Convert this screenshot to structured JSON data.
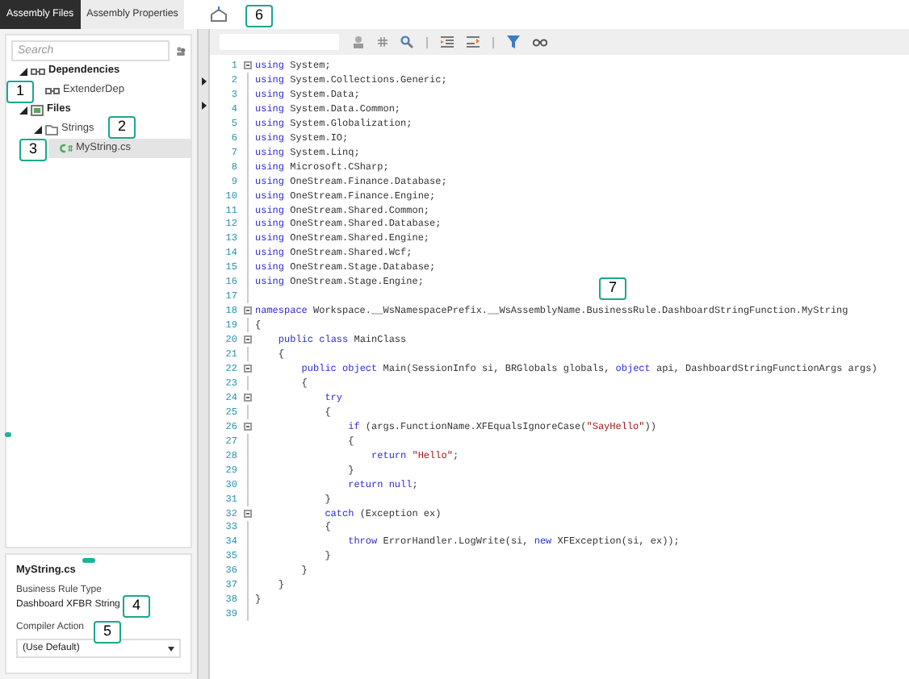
{
  "tabs": [
    {
      "label": "Assembly Files",
      "selected": true
    },
    {
      "label": "Assembly Properties",
      "selected": false
    }
  ],
  "search": {
    "placeholder": "Search"
  },
  "tree": [
    {
      "label": "Dependencies",
      "kind": "deps",
      "expanded": true,
      "selected": false,
      "children": [
        {
          "label": "ExtenderDep",
          "kind": "dep",
          "selected": false
        }
      ]
    },
    {
      "label": "Files",
      "kind": "files",
      "expanded": true,
      "selected": false,
      "children": [
        {
          "label": "Strings",
          "kind": "folder",
          "expanded": true,
          "selected": false,
          "children": [
            {
              "label": "MyString.cs",
              "kind": "cs",
              "selected": true
            }
          ]
        }
      ]
    }
  ],
  "properties": {
    "title": "MyString.cs",
    "fields": [
      {
        "kind": "text",
        "label": "Business Rule Type",
        "value": "Dashboard XFBR String"
      },
      {
        "kind": "dropdown",
        "label": "Compiler Action",
        "value": "(Use Default)"
      }
    ]
  },
  "code": [
    {
      "n": "1",
      "fold": true,
      "tokens": [
        {
          "kind": "keyword",
          "t": "using"
        },
        {
          "kind": "plain",
          "t": " System;"
        }
      ]
    },
    {
      "n": "2",
      "fold": false,
      "tokens": [
        {
          "kind": "keyword",
          "t": "using"
        },
        {
          "kind": "plain",
          "t": " System.Collections.Generic;"
        }
      ]
    },
    {
      "n": "3",
      "fold": false,
      "tokens": [
        {
          "kind": "keyword",
          "t": "using"
        },
        {
          "kind": "plain",
          "t": " System.Data;"
        }
      ]
    },
    {
      "n": "4",
      "fold": false,
      "tokens": [
        {
          "kind": "keyword",
          "t": "using"
        },
        {
          "kind": "plain",
          "t": " System.Data.Common;"
        }
      ]
    },
    {
      "n": "5",
      "fold": false,
      "tokens": [
        {
          "kind": "keyword",
          "t": "using"
        },
        {
          "kind": "plain",
          "t": " System.Globalization;"
        }
      ]
    },
    {
      "n": "6",
      "fold": false,
      "tokens": [
        {
          "kind": "keyword",
          "t": "using"
        },
        {
          "kind": "plain",
          "t": " System.IO;"
        }
      ]
    },
    {
      "n": "7",
      "fold": false,
      "tokens": [
        {
          "kind": "keyword",
          "t": "using"
        },
        {
          "kind": "plain",
          "t": " System.Linq;"
        }
      ]
    },
    {
      "n": "8",
      "fold": false,
      "tokens": [
        {
          "kind": "keyword",
          "t": "using"
        },
        {
          "kind": "plain",
          "t": " Microsoft.CSharp;"
        }
      ]
    },
    {
      "n": "9",
      "fold": false,
      "tokens": [
        {
          "kind": "keyword",
          "t": "using"
        },
        {
          "kind": "plain",
          "t": " OneStream.Finance.Database;"
        }
      ]
    },
    {
      "n": "10",
      "fold": false,
      "tokens": [
        {
          "kind": "keyword",
          "t": "using"
        },
        {
          "kind": "plain",
          "t": " OneStream.Finance.Engine;"
        }
      ]
    },
    {
      "n": "11",
      "fold": false,
      "tokens": [
        {
          "kind": "keyword",
          "t": "using"
        },
        {
          "kind": "plain",
          "t": " OneStream.Shared.Common;"
        }
      ]
    },
    {
      "n": "12",
      "fold": false,
      "tokens": [
        {
          "kind": "keyword",
          "t": "using"
        },
        {
          "kind": "plain",
          "t": " OneStream.Shared.Database;"
        }
      ]
    },
    {
      "n": "13",
      "fold": false,
      "tokens": [
        {
          "kind": "keyword",
          "t": "using"
        },
        {
          "kind": "plain",
          "t": " OneStream.Shared.Engine;"
        }
      ]
    },
    {
      "n": "14",
      "fold": false,
      "tokens": [
        {
          "kind": "keyword",
          "t": "using"
        },
        {
          "kind": "plain",
          "t": " OneStream.Shared.Wcf;"
        }
      ]
    },
    {
      "n": "15",
      "fold": false,
      "tokens": [
        {
          "kind": "keyword",
          "t": "using"
        },
        {
          "kind": "plain",
          "t": " OneStream.Stage.Database;"
        }
      ]
    },
    {
      "n": "16",
      "fold": false,
      "tokens": [
        {
          "kind": "keyword",
          "t": "using"
        },
        {
          "kind": "plain",
          "t": " OneStream.Stage.Engine;"
        }
      ]
    },
    {
      "n": "17",
      "fold": false
    },
    {
      "n": "18",
      "fold": true,
      "tokens": [
        {
          "kind": "keyword",
          "t": "namespace"
        },
        {
          "kind": "plain",
          "t": " Workspace.__WsNamespacePrefix.__WsAssemblyName.BusinessRule.DashboardStringFunction.MyString"
        }
      ]
    },
    {
      "n": "19",
      "fold": false,
      "tokens": [
        {
          "kind": "plain",
          "t": "{"
        }
      ]
    },
    {
      "n": "20",
      "fold": true,
      "tokens": [
        {
          "kind": "keyword",
          "t": "    public"
        },
        {
          "kind": "keyword",
          "t": " class"
        },
        {
          "kind": "plain",
          "t": " MainClass"
        }
      ]
    },
    {
      "n": "21",
      "fold": false,
      "tokens": [
        {
          "kind": "plain",
          "t": "    {"
        }
      ]
    },
    {
      "n": "22",
      "fold": true,
      "tokens": [
        {
          "kind": "keyword",
          "t": "        public"
        },
        {
          "kind": "keyword",
          "t": " object"
        },
        {
          "kind": "plain",
          "t": " Main(SessionInfo si, BRGlobals globals, "
        },
        {
          "kind": "keyword",
          "t": "object"
        },
        {
          "kind": "plain",
          "t": " api, DashboardStringFunctionArgs args)"
        }
      ]
    },
    {
      "n": "23",
      "fold": false,
      "tokens": [
        {
          "kind": "plain",
          "t": "        {"
        }
      ]
    },
    {
      "n": "24",
      "fold": true,
      "tokens": [
        {
          "kind": "keyword",
          "t": "            try"
        }
      ]
    },
    {
      "n": "25",
      "fold": false,
      "tokens": [
        {
          "kind": "plain",
          "t": "            {"
        }
      ]
    },
    {
      "n": "26",
      "fold": true,
      "tokens": [
        {
          "kind": "keyword",
          "t": "                if"
        },
        {
          "kind": "plain",
          "t": " (args.FunctionName.XFEqualsIgnoreCase("
        },
        {
          "kind": "string",
          "t": "\"SayHello\""
        },
        {
          "kind": "plain",
          "t": "))"
        }
      ]
    },
    {
      "n": "27",
      "fold": false,
      "tokens": [
        {
          "kind": "plain",
          "t": "                {"
        }
      ]
    },
    {
      "n": "28",
      "fold": false,
      "tokens": [
        {
          "kind": "keyword",
          "t": "                    return"
        },
        {
          "kind": "string",
          "t": " \"Hello\""
        },
        {
          "kind": "plain",
          "t": ";"
        }
      ]
    },
    {
      "n": "29",
      "fold": false,
      "tokens": [
        {
          "kind": "plain",
          "t": "                }"
        }
      ]
    },
    {
      "n": "30",
      "fold": false,
      "tokens": [
        {
          "kind": "keyword",
          "t": "                return"
        },
        {
          "kind": "keyword",
          "t": " null"
        },
        {
          "kind": "plain",
          "t": ";"
        }
      ]
    },
    {
      "n": "31",
      "fold": false,
      "tokens": [
        {
          "kind": "plain",
          "t": "            }"
        }
      ]
    },
    {
      "n": "32",
      "fold": true,
      "tokens": [
        {
          "kind": "keyword",
          "t": "            catch"
        },
        {
          "kind": "plain",
          "t": " (Exception ex)"
        }
      ]
    },
    {
      "n": "33",
      "fold": false,
      "tokens": [
        {
          "kind": "plain",
          "t": "            {"
        }
      ]
    },
    {
      "n": "34",
      "fold": false,
      "tokens": [
        {
          "kind": "keyword",
          "t": "                throw"
        },
        {
          "kind": "plain",
          "t": " ErrorHandler.LogWrite(si, "
        },
        {
          "kind": "keyword",
          "t": "new"
        },
        {
          "kind": "plain",
          "t": " XFException(si, ex));"
        }
      ]
    },
    {
      "n": "35",
      "fold": false,
      "tokens": [
        {
          "kind": "plain",
          "t": "            }"
        }
      ]
    },
    {
      "n": "36",
      "fold": false,
      "tokens": [
        {
          "kind": "plain",
          "t": "        }"
        }
      ]
    },
    {
      "n": "37",
      "fold": false,
      "tokens": [
        {
          "kind": "plain",
          "t": "    }"
        }
      ]
    },
    {
      "n": "38",
      "fold": false,
      "tokens": [
        {
          "kind": "plain",
          "t": "}"
        }
      ]
    },
    {
      "n": "39",
      "fold": false
    }
  ],
  "callouts": [
    {
      "text": "1"
    },
    {
      "text": "2"
    },
    {
      "text": "3"
    },
    {
      "text": "4"
    },
    {
      "text": "5"
    },
    {
      "text": "6"
    },
    {
      "text": "7"
    }
  ]
}
